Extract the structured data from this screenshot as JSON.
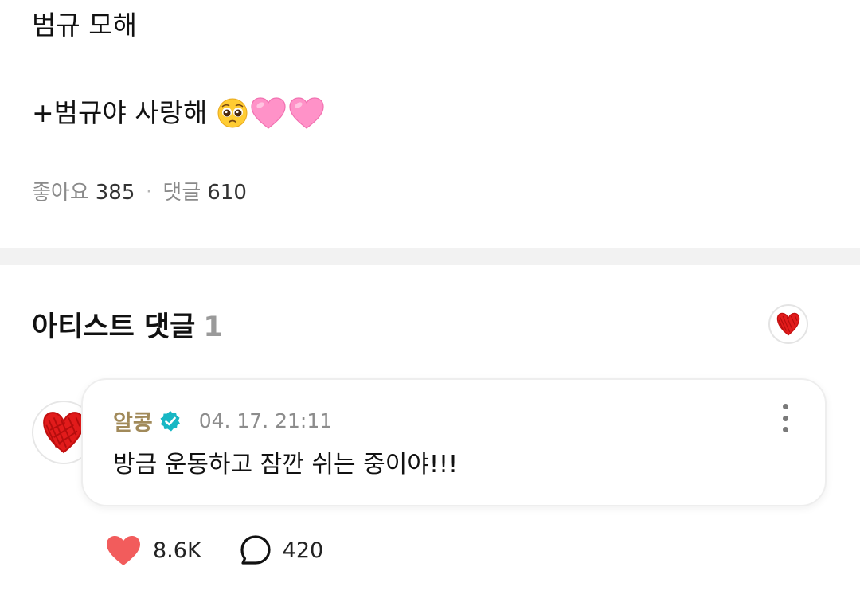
{
  "post": {
    "title": "범규 모해",
    "line": "+범규야 사랑해",
    "emojis": [
      "pleading-face-icon",
      "pink-heart-icon",
      "pink-heart-icon"
    ],
    "stats": {
      "likes_label": "좋아요",
      "likes_count": "385",
      "separator": "·",
      "comments_label": "댓글",
      "comments_count": "610"
    }
  },
  "artist_comments": {
    "title": "아티스트 댓글",
    "count": "1",
    "comment": {
      "author": "알콩",
      "verified_icon": "verified-badge-icon",
      "timestamp": "04. 17. 21:11",
      "text": "방금 운동하고 잠깐 쉬는 중이야!!!",
      "likes": "8.6K",
      "replies": "420"
    }
  },
  "colors": {
    "author": "#a18a5a",
    "verified": "#18b7c4",
    "like_heart": "#f25c5c",
    "pink_heart": "#ff8fc6",
    "divider": "#f2f2f2"
  }
}
